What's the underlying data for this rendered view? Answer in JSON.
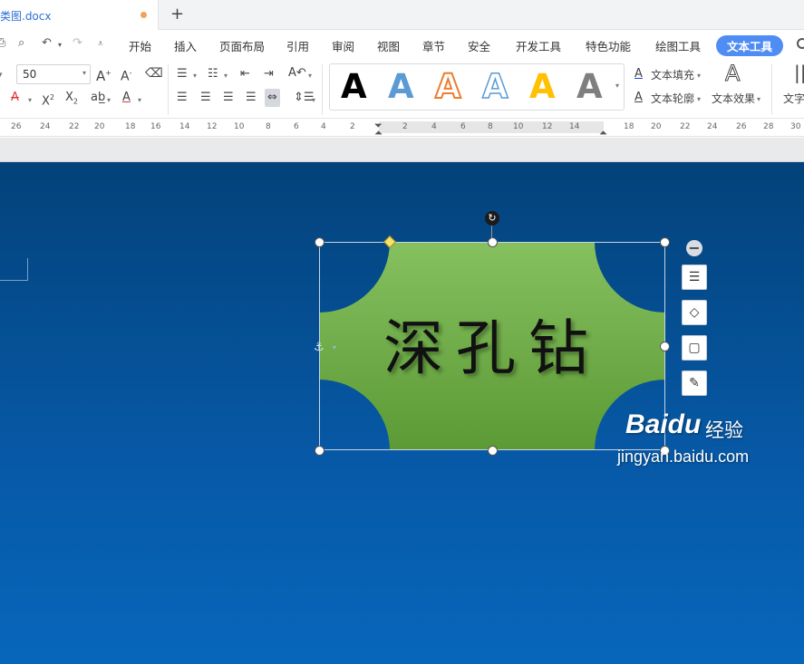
{
  "tab": {
    "doc_name": "类图.docx",
    "new_tab": "+"
  },
  "menu": {
    "items": [
      "开始",
      "插入",
      "页面布局",
      "引用",
      "审阅",
      "视图",
      "章节",
      "安全",
      "开发工具",
      "特色功能",
      "绘图工具",
      "文本工具"
    ],
    "active": "文本工具"
  },
  "ribbon": {
    "font_size": "50",
    "text_fill": "文本填充",
    "text_outline": "文本轮廓",
    "text_effect": "文本效果",
    "text_cut": "文字",
    "style_glyph": "A",
    "gallery_colors": [
      "#000000",
      "#5b9bd5",
      "#ed7d31",
      "#ffffff",
      "#ffc000",
      "#7f7f7f"
    ]
  },
  "ruler": {
    "left_numbers": [
      "26",
      "24",
      "22",
      "20",
      "18",
      "16",
      "14",
      "12",
      "10",
      "8",
      "6",
      "4",
      "2"
    ],
    "right_numbers": [
      "2",
      "4",
      "6",
      "8",
      "10",
      "12",
      "14",
      "18",
      "20",
      "22",
      "24",
      "26",
      "28",
      "30"
    ]
  },
  "canvas": {
    "shape_text": "深孔钻",
    "shape_fill": "#6cab45",
    "background": "#0759a7"
  },
  "watermark": {
    "brand": "Bai⁠du",
    "cn": "经验",
    "url": "jingyan.baidu.com"
  },
  "icons": [
    "rotate-icon",
    "collapse-icon",
    "wrap-text-icon",
    "fill-icon",
    "outline-icon",
    "brush-icon",
    "anchor-icon"
  ]
}
